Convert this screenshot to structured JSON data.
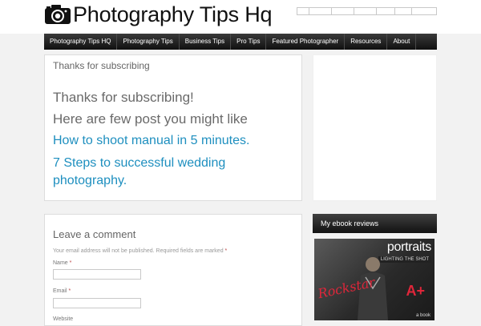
{
  "header": {
    "title": "Photography Tips Hq",
    "logo_icon": "camera-icon",
    "top_links": [
      {
        "label": ""
      },
      {
        "label": ""
      },
      {
        "label": ""
      },
      {
        "label": ""
      },
      {
        "label": ""
      },
      {
        "label": ""
      },
      {
        "label": ""
      }
    ]
  },
  "nav": {
    "items": [
      {
        "label": "Photography Tips HQ"
      },
      {
        "label": "Photography Tips"
      },
      {
        "label": "Business Tips"
      },
      {
        "label": "Pro Tips"
      },
      {
        "label": "Featured Photographer"
      },
      {
        "label": "Resources"
      },
      {
        "label": "About"
      }
    ]
  },
  "main": {
    "page_title": "Thanks for subscribing",
    "heading": "Thanks for subscribing!",
    "subheading": "Here are few post you might like",
    "links": [
      {
        "label": "How to shoot manual in 5 minutes."
      },
      {
        "label": "7 Steps to successful wedding photography."
      }
    ]
  },
  "comment": {
    "title": "Leave a comment",
    "note": "Your email address will not be published. Required fields are marked",
    "required_mark": "*",
    "fields": [
      {
        "label": "Name",
        "value": ""
      },
      {
        "label": "Email",
        "value": ""
      },
      {
        "label": "Website",
        "value": ""
      }
    ]
  },
  "sidebar": {
    "ebook_title": "My ebook reviews",
    "cover": {
      "word": "portraits",
      "subtitle": "LIGHTING THE SHOT",
      "scribble": "Rockstar",
      "plus": "A+",
      "badge": "a book"
    }
  },
  "colors": {
    "link": "#1e8fbf",
    "nav_bg": "#1a1a1a",
    "accent_red": "#e0263a"
  }
}
